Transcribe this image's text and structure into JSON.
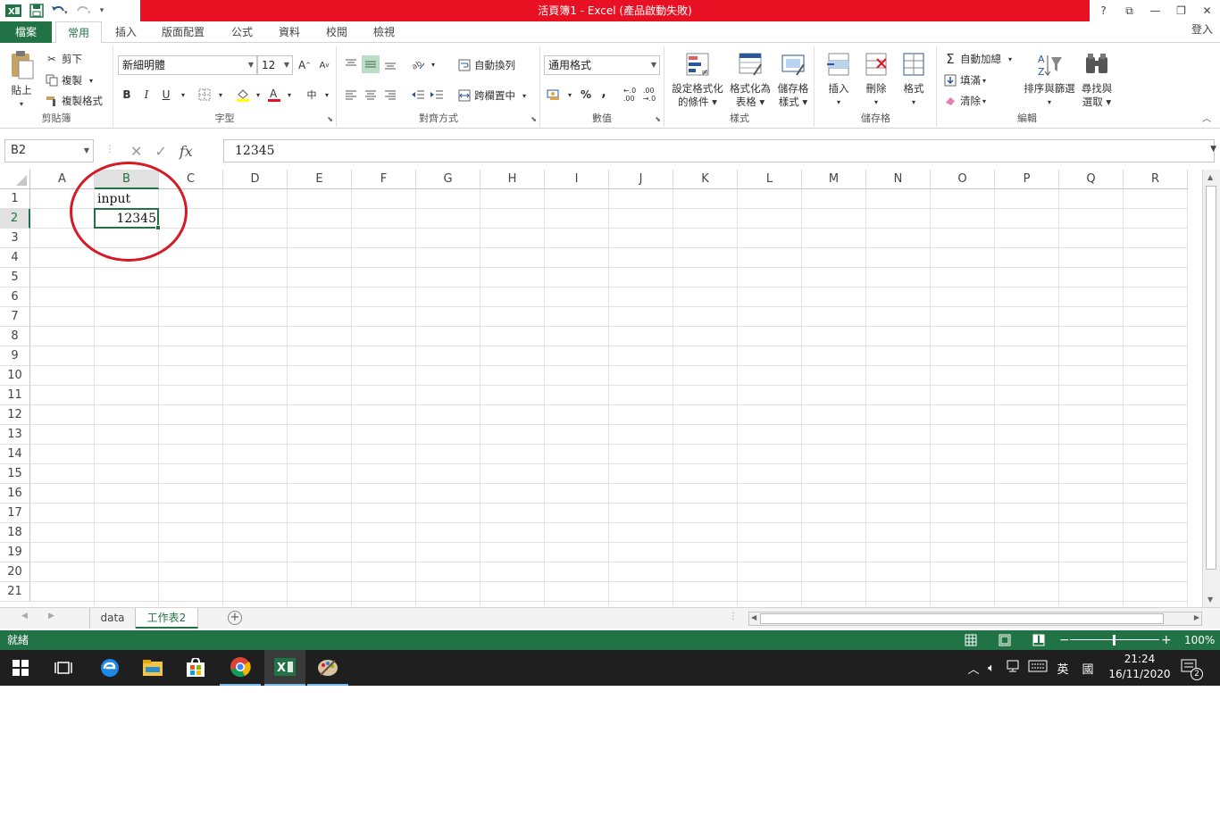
{
  "window": {
    "title": "活頁簿1 - Excel (產品啟動失敗)",
    "controls": {
      "help": "?",
      "ribbon_display": "⧉",
      "minimize": "—",
      "restore": "❐",
      "close": "✕"
    }
  },
  "tabs": [
    "檔案",
    "常用",
    "插入",
    "版面配置",
    "公式",
    "資料",
    "校閱",
    "檢視"
  ],
  "signin": "登入",
  "ribbon": {
    "clipboard": {
      "paste": "貼上",
      "cut": "剪下",
      "copy": "複製",
      "format_painter": "複製格式",
      "label": "剪貼簿"
    },
    "font": {
      "name": "新細明體",
      "size": "12",
      "bold": "B",
      "italic": "I",
      "underline": "U",
      "label": "字型"
    },
    "alignment": {
      "wrap": "自動換列",
      "merge": "跨欄置中",
      "label": "對齊方式"
    },
    "number": {
      "format": "通用格式",
      "percent": "%",
      "comma": ",",
      "label": "數值"
    },
    "styles": {
      "conditional": [
        "設定格式化",
        "的條件"
      ],
      "as_table": [
        "格式化為",
        "表格"
      ],
      "cell_styles": [
        "儲存格",
        "樣式"
      ],
      "label": "樣式"
    },
    "cells": {
      "insert": "插入",
      "delete": "刪除",
      "format": "格式",
      "label": "儲存格"
    },
    "editing": {
      "autosum": "自動加總",
      "fill": "填滿",
      "clear": "清除",
      "sort": [
        "排序與篩選"
      ],
      "find": [
        "尋找與",
        "選取"
      ],
      "label": "編輯"
    }
  },
  "formula_bar": {
    "name_box": "B2",
    "fx": "fx",
    "value": "12345"
  },
  "grid": {
    "columns": [
      "A",
      "B",
      "C",
      "D",
      "E",
      "F",
      "G",
      "H",
      "I",
      "J",
      "K",
      "L",
      "M",
      "N",
      "O",
      "P",
      "Q",
      "R"
    ],
    "rows": [
      "1",
      "2",
      "3",
      "4",
      "5",
      "6",
      "7",
      "8",
      "9",
      "10",
      "11",
      "12",
      "13",
      "14",
      "15",
      "16",
      "17",
      "18",
      "19",
      "20",
      "21"
    ],
    "selected_cell": "B2",
    "cells": {
      "B1": "input",
      "B2": "12345"
    }
  },
  "sheets": [
    "data",
    "工作表2"
  ],
  "active_sheet": "工作表2",
  "status": {
    "ready": "就緒",
    "zoom": "100%"
  },
  "taskbar": {
    "ime_lang": "英",
    "ime_mode": "國",
    "time": "21:24",
    "date": "16/11/2020",
    "notifications": "2"
  },
  "colors": {
    "excel_green": "#217346",
    "title_red": "#e81123",
    "annotation_red": "#d61a23"
  }
}
